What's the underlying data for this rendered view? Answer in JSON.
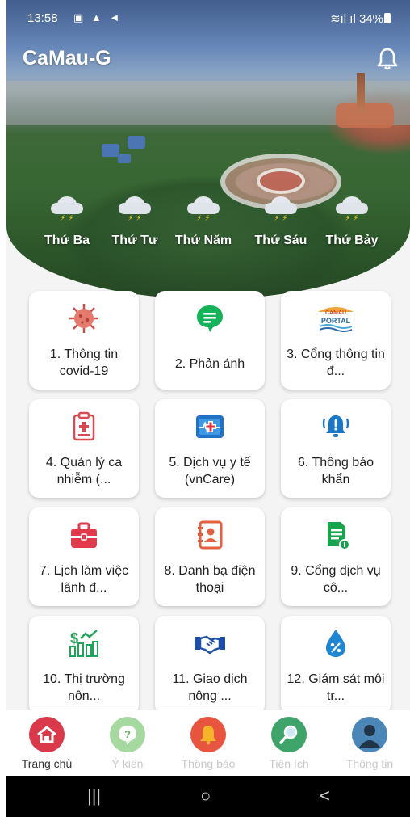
{
  "status_bar": {
    "time": "13:58",
    "left_icons": "▣ ▲ ◄",
    "right_text": "34%"
  },
  "header": {
    "title": "CaMau-G",
    "bell_icon": "bell-icon"
  },
  "weather": [
    {
      "day": "Thứ Ba",
      "icon": "rain-cloud-icon"
    },
    {
      "day": "Thứ Tư",
      "icon": "rain-cloud-icon"
    },
    {
      "day": "Thứ Năm",
      "icon": "rain-cloud-icon"
    },
    {
      "day": "Thứ Sáu",
      "icon": "rain-cloud-icon"
    },
    {
      "day": "Thứ Bảy",
      "icon": "rain-cloud-icon"
    }
  ],
  "tiles": [
    {
      "label": "1. Thông tin covid-19",
      "icon": "virus-icon"
    },
    {
      "label": "2. Phản ánh",
      "icon": "chat-bubble-icon"
    },
    {
      "label": "3. Cổng thông tin đ...",
      "icon": "camau-portal-logo",
      "logo_text": [
        "CAMAU",
        "PORTAL"
      ]
    },
    {
      "label": "4. Quản lý ca nhiễm (...",
      "icon": "medical-clipboard-icon"
    },
    {
      "label": "5. Dịch vụ y tế (vnCare)",
      "icon": "heart-monitor-icon"
    },
    {
      "label": "6. Thông báo khẩn",
      "icon": "alarm-bell-icon"
    },
    {
      "label": "7. Lịch làm việc lãnh đ...",
      "icon": "briefcase-icon"
    },
    {
      "label": "8. Danh bạ điện thoại",
      "icon": "contact-book-icon"
    },
    {
      "label": "9. Cổng dịch vụ cô...",
      "icon": "document-icon"
    },
    {
      "label": "10. Thị trường nôn...",
      "icon": "market-chart-icon"
    },
    {
      "label": "11. Giao dịch nông ...",
      "icon": "handshake-icon"
    },
    {
      "label": "12. Giám sát môi tr...",
      "icon": "water-drop-icon"
    }
  ],
  "nav": [
    {
      "label": "Trang chủ",
      "icon": "home-icon",
      "color": "#d9394b",
      "active": true
    },
    {
      "label": "Ý kiến",
      "icon": "question-icon",
      "color": "#a6d9a0",
      "active": false
    },
    {
      "label": "Thông báo",
      "icon": "bell-icon",
      "color": "#e8553f",
      "active": false
    },
    {
      "label": "Tiện ích",
      "icon": "search-icon",
      "color": "#3fa46a",
      "active": false
    },
    {
      "label": "Thông tin",
      "icon": "user-icon",
      "color": "#4b86b8",
      "active": false
    }
  ],
  "system_nav": {
    "recents": "|||",
    "home": "○",
    "back": "<"
  }
}
